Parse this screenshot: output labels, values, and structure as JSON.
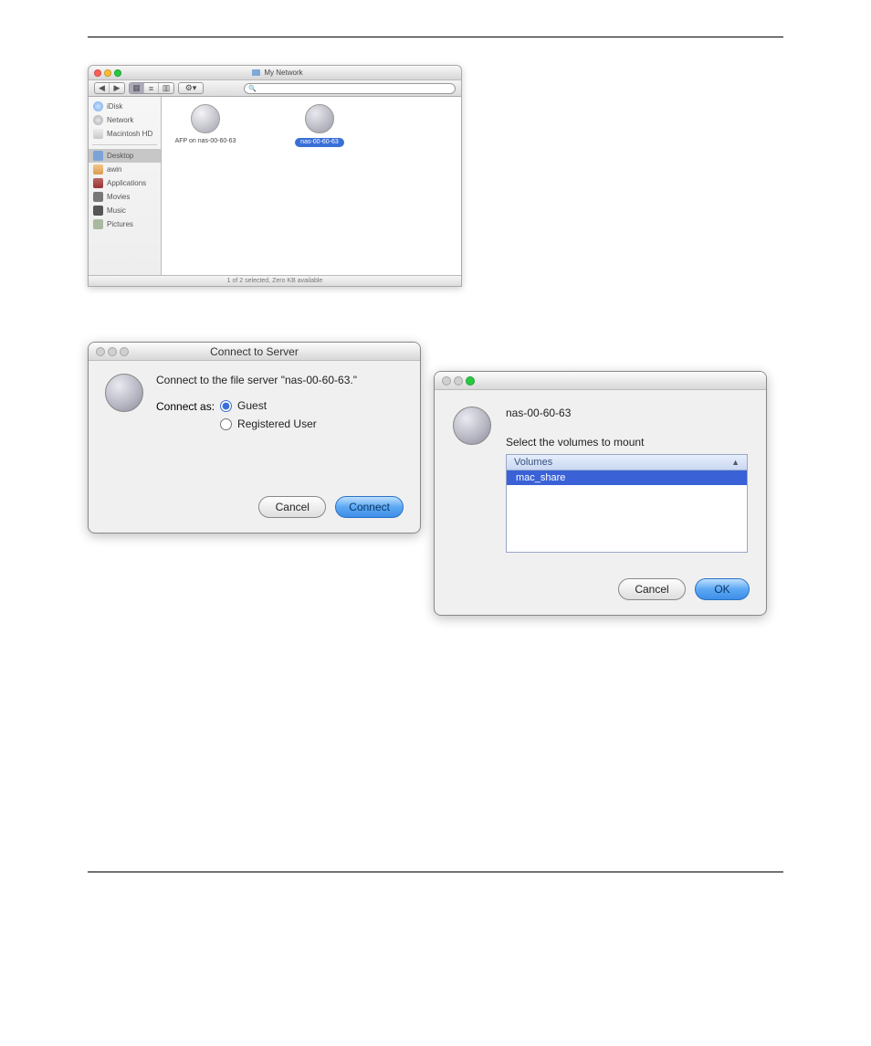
{
  "finder": {
    "title": "My Network",
    "search_placeholder": "",
    "sidebar": {
      "items": [
        {
          "label": "iDisk"
        },
        {
          "label": "Network"
        },
        {
          "label": "Macintosh HD"
        }
      ],
      "places": [
        {
          "label": "Desktop"
        },
        {
          "label": "awin"
        },
        {
          "label": "Applications"
        },
        {
          "label": "Movies"
        },
        {
          "label": "Music"
        },
        {
          "label": "Pictures"
        }
      ]
    },
    "content": {
      "items": [
        {
          "label": "AFP on nas-00-60-63",
          "selected": false
        },
        {
          "label": "nas-00-60-63",
          "selected": true
        }
      ]
    },
    "status": "1 of 2 selected, Zero KB available"
  },
  "connect": {
    "title": "Connect to Server",
    "prompt": "Connect to the file server \"nas-00-60-63.\"",
    "connect_as_label": "Connect as:",
    "options": {
      "guest": "Guest",
      "registered": "Registered User"
    },
    "buttons": {
      "cancel": "Cancel",
      "connect": "Connect"
    }
  },
  "volumes": {
    "server": "nas-00-60-63",
    "instruction": "Select the volumes to mount",
    "column_header": "Volumes",
    "items": [
      "mac_share"
    ],
    "buttons": {
      "cancel": "Cancel",
      "ok": "OK"
    }
  }
}
